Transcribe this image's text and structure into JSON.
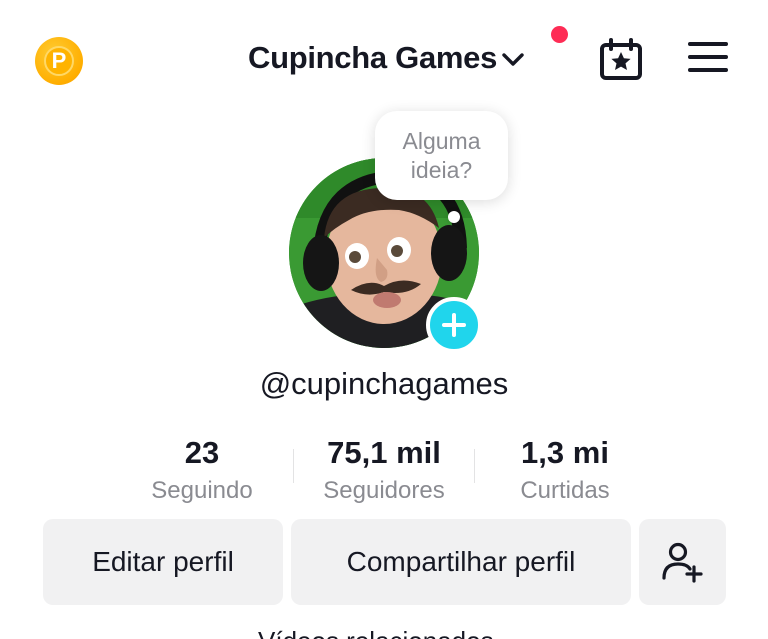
{
  "header": {
    "coin_icon": "coin-icon",
    "coin_letter": "P",
    "account_name": "Cupincha Games",
    "notification_color": "#fe2c55",
    "calendar_icon": "calendar-star-icon",
    "menu_icon": "hamburger-menu-icon"
  },
  "profile": {
    "bubble_text": "Alguma\nideia?",
    "username": "@cupinchagames",
    "add_icon": "plus-icon",
    "accent_color": "#20d5ec"
  },
  "stats": [
    {
      "value": "23",
      "label": "Seguindo"
    },
    {
      "value": "75,1 mil",
      "label": "Seguidores"
    },
    {
      "value": "1,3 mi",
      "label": "Curtidas"
    }
  ],
  "actions": {
    "edit_label": "Editar perfil",
    "share_label": "Compartilhar perfil",
    "add_friend_icon": "add-friend-icon"
  },
  "footer": {
    "peek_text": "Vídeos relacionados"
  }
}
